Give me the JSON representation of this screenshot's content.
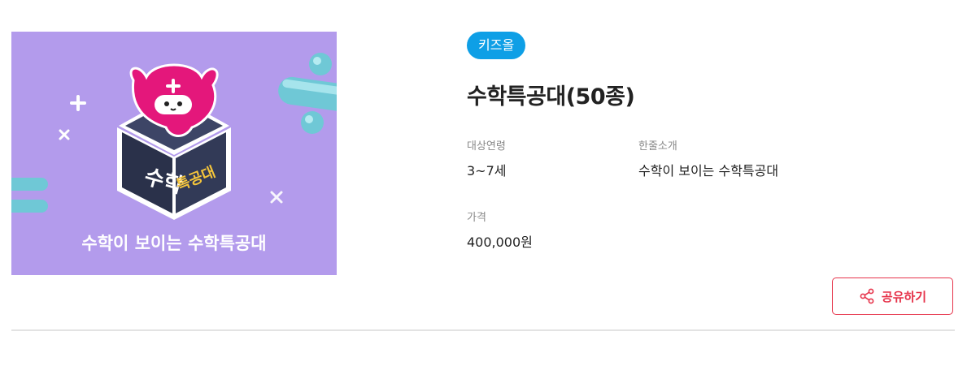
{
  "product": {
    "badge": "키즈올",
    "title": "수학특공대(50종)",
    "image": {
      "logo_word_1": "수학",
      "logo_word_2": "특공대",
      "caption": "수학이 보이는 수학특공대",
      "colors": {
        "background": "#b39bec",
        "character": "#e4177b",
        "box_dark": "#2e3550",
        "tube": "#6fc8d6"
      }
    },
    "info": [
      {
        "label": "대상연령",
        "value": "3~7세"
      },
      {
        "label": "한줄소개",
        "value": "수학이 보이는 수학특공대"
      },
      {
        "label": "가격",
        "value": "400,000원"
      }
    ]
  },
  "actions": {
    "share_label": "공유하기",
    "share_icon": "share-icon"
  },
  "colors": {
    "badge": "#0e9fe6",
    "accent": "#e6334a"
  }
}
